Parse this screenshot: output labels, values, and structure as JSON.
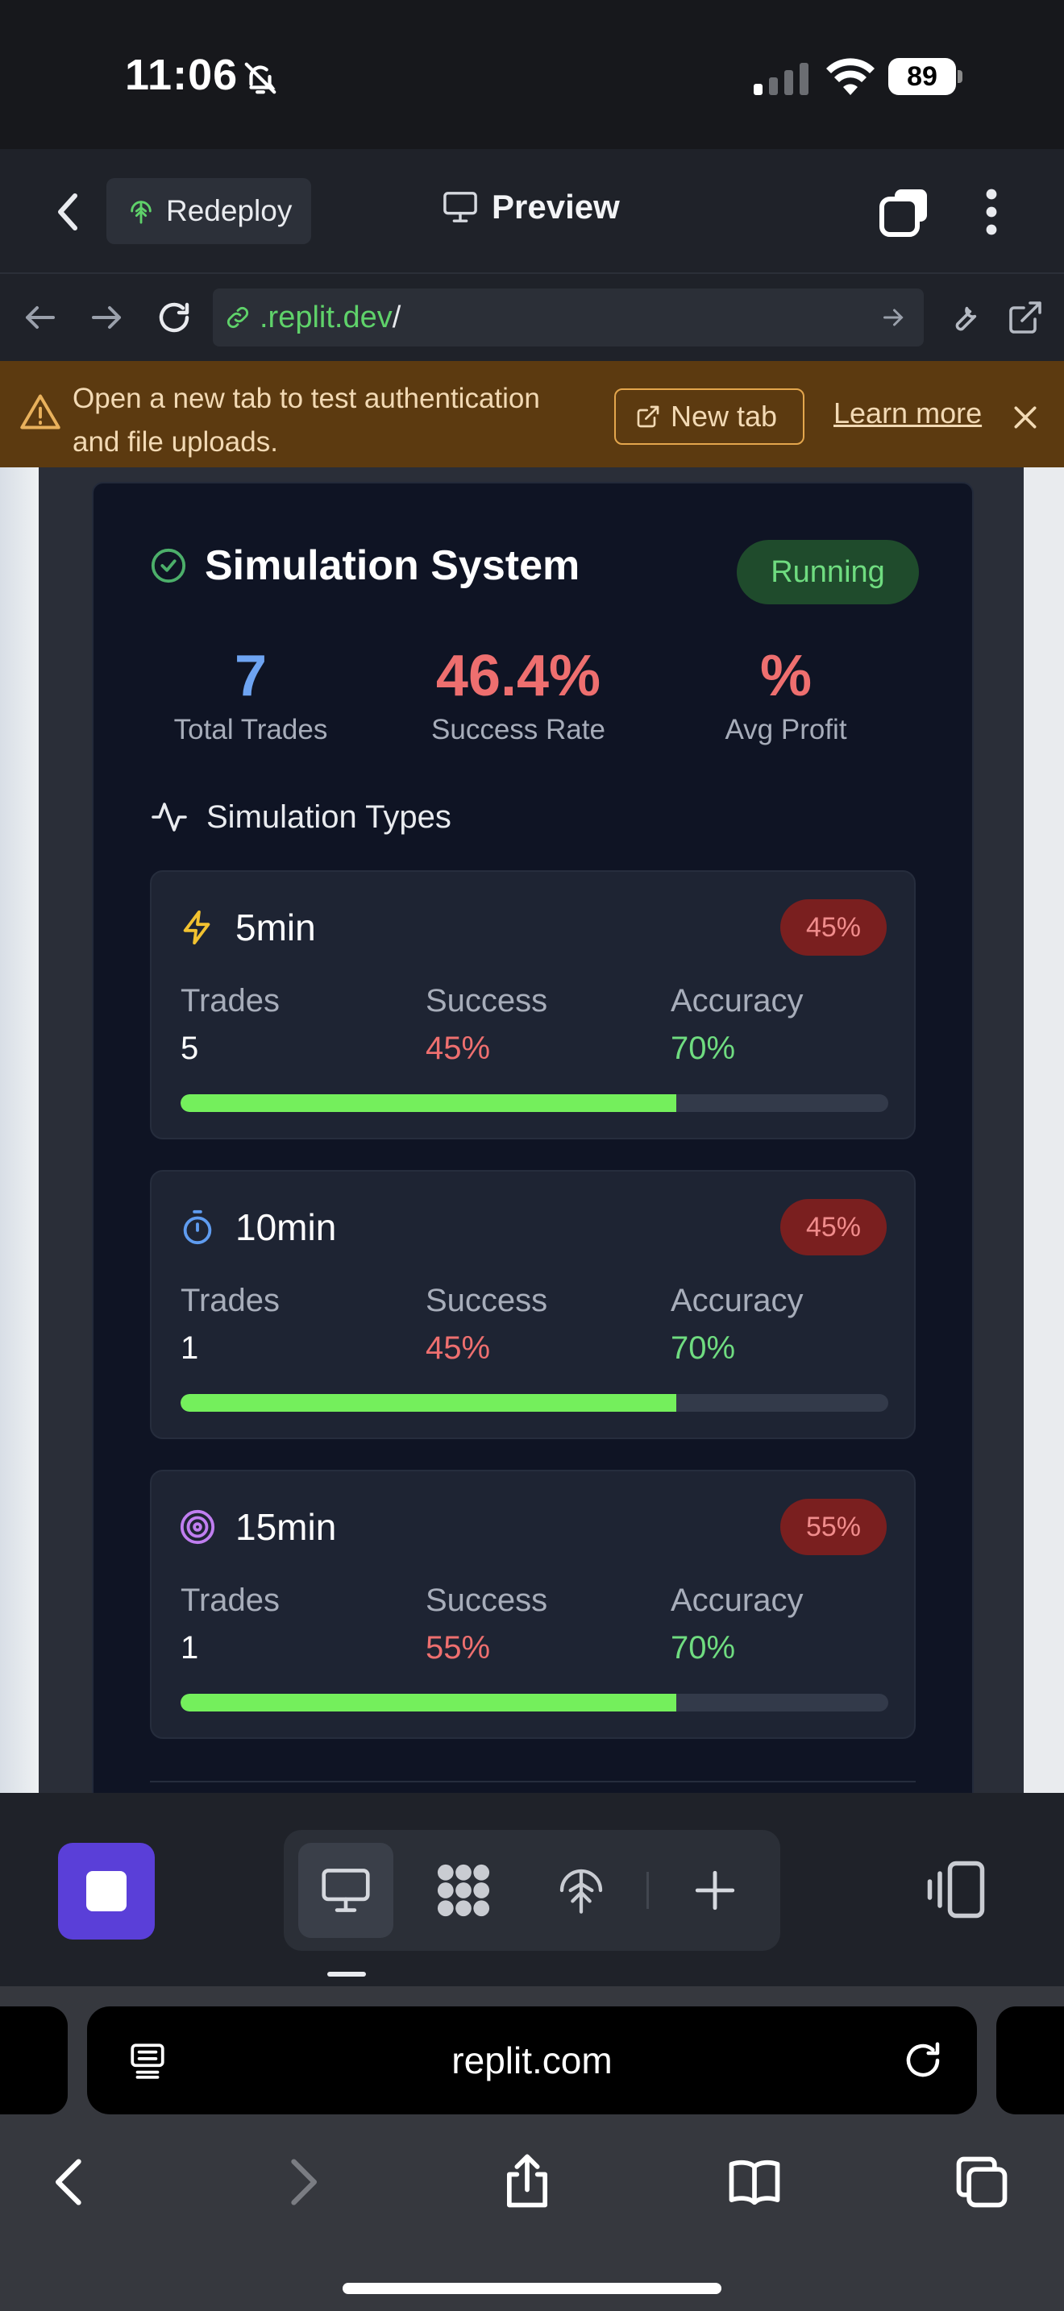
{
  "status_bar": {
    "time": "11:06",
    "battery": "89"
  },
  "app_bar": {
    "redeploy_label": "Redeploy",
    "preview_label": "Preview"
  },
  "url_bar": {
    "url_prefix": ".replit.dev",
    "url_suffix": "/"
  },
  "banner": {
    "message": "Open a new tab to test authentication and file uploads.",
    "new_tab_label": "New tab",
    "learn_more_label": "Learn more"
  },
  "simulation": {
    "title": "Simulation System",
    "status": "Running",
    "stats": [
      {
        "value": "7",
        "label": "Total Trades",
        "color": "#6ea4f2"
      },
      {
        "value": "46.4%",
        "label": "Success Rate",
        "color": "#ee6f6f"
      },
      {
        "value": "%",
        "label": "Avg Profit",
        "color": "#ee6f6f"
      }
    ],
    "types_heading": "Simulation Types",
    "types": [
      {
        "name": "5min",
        "icon": "lightning-icon",
        "badge": "45%",
        "trades_label": "Trades",
        "trades": "5",
        "success_label": "Success",
        "success": "45%",
        "accuracy_label": "Accuracy",
        "accuracy": "70%",
        "accuracy_fraction": 0.7
      },
      {
        "name": "10min",
        "icon": "timer-icon",
        "badge": "45%",
        "trades_label": "Trades",
        "trades": "1",
        "success_label": "Success",
        "success": "45%",
        "accuracy_label": "Accuracy",
        "accuracy": "70%",
        "accuracy_fraction": 0.7
      },
      {
        "name": "15min",
        "icon": "target-icon",
        "badge": "55%",
        "trades_label": "Trades",
        "trades": "1",
        "success_label": "Success",
        "success": "55%",
        "accuracy_label": "Accuracy",
        "accuracy": "70%",
        "accuracy_fraction": 0.7
      }
    ]
  },
  "colors": {
    "accent_green": "#74ef5c",
    "success_red": "#ee6f6f",
    "accuracy_green": "#6fdc80",
    "trades_blue": "#6ea4f2"
  },
  "safari": {
    "domain": "replit.com"
  }
}
